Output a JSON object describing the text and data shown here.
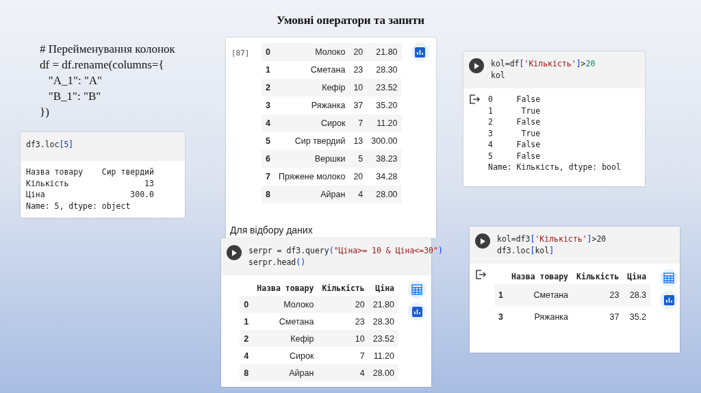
{
  "title": "Умовні оператори та запити",
  "note_lines": [
    "# Перейменування колонок",
    "df = df.rename(columns={",
    "   \"A_1\": \"A\"",
    "   \"B_1\": \"B\"",
    "})"
  ],
  "panels": [
    {
      "code": [
        [
          {
            "kind": "plain",
            "text": "df3.loc"
          },
          {
            "kind": "bracket",
            "text": "[5]"
          }
        ]
      ],
      "output_lines": [
        "Назва товару    Сир твердий",
        "Кількість                13",
        "Ціна                  300.0",
        "Name: 5, dtype: object"
      ]
    },
    {
      "exec_count": "[87]",
      "table": {
        "rows": [
          {
            "index": "0",
            "cells": [
              "Молоко",
              "20",
              "21.80"
            ]
          },
          {
            "index": "1",
            "cells": [
              "Сметана",
              "23",
              "28.30"
            ]
          },
          {
            "index": "2",
            "cells": [
              "Кефір",
              "10",
              "23.52"
            ]
          },
          {
            "index": "3",
            "cells": [
              "Ряжанка",
              "37",
              "35.20"
            ]
          },
          {
            "index": "4",
            "cells": [
              "Сирок",
              "7",
              "11.20"
            ]
          },
          {
            "index": "5",
            "cells": [
              "Сир твердий",
              "13",
              "300.00"
            ]
          },
          {
            "index": "6",
            "cells": [
              "Вершки",
              "5",
              "38.23"
            ]
          },
          {
            "index": "7",
            "cells": [
              "Пряжене молоко",
              "20",
              "34.28"
            ]
          },
          {
            "index": "8",
            "cells": [
              "Айран",
              "4",
              "28.00"
            ]
          }
        ],
        "chart_button": true
      },
      "caption": "Для відбору даних"
    },
    {
      "run_button": true,
      "output_icon": true,
      "code": [
        [
          {
            "kind": "plain",
            "text": "kol=df"
          },
          {
            "kind": "bracket",
            "text": "["
          },
          {
            "kind": "string",
            "text": "'Кількість'"
          },
          {
            "kind": "bracket",
            "text": "]"
          },
          {
            "kind": "plain",
            "text": ">"
          },
          {
            "kind": "number",
            "text": "20"
          }
        ],
        [
          {
            "kind": "plain",
            "text": "kol"
          }
        ]
      ],
      "output_lines": [
        "0     False",
        "1      True",
        "2     False",
        "3      True",
        "4     False",
        "5     False",
        "Name: Кількість, dtype: bool"
      ]
    },
    {
      "run_button": true,
      "code": [
        [
          {
            "kind": "plain",
            "text": "serpr = df3.query"
          },
          {
            "kind": "bracket",
            "text": "("
          },
          {
            "kind": "string",
            "text": "\"Ціна>= 10 & Ціна<=30\""
          },
          {
            "kind": "bracket",
            "text": ")"
          }
        ],
        [
          {
            "kind": "plain",
            "text": "serpr.head"
          },
          {
            "kind": "bracket",
            "text": "()"
          }
        ]
      ],
      "table": {
        "columns": [
          "Назва товару",
          "Кількість",
          "Ціна"
        ],
        "rows": [
          {
            "index": "0",
            "cells": [
              "Молоко",
              "20",
              "21.80"
            ]
          },
          {
            "index": "1",
            "cells": [
              "Сметана",
              "23",
              "28.30"
            ]
          },
          {
            "index": "2",
            "cells": [
              "Кефір",
              "10",
              "23.52"
            ]
          },
          {
            "index": "4",
            "cells": [
              "Сирок",
              "7",
              "11.20"
            ]
          },
          {
            "index": "8",
            "cells": [
              "Айран",
              "4",
              "28.00"
            ]
          }
        ],
        "table_button": true,
        "chart_button": true
      }
    },
    {
      "run_button": true,
      "output_icon": true,
      "code": [
        [
          {
            "kind": "plain",
            "text": "kol=df3"
          },
          {
            "kind": "bracket",
            "text": "["
          },
          {
            "kind": "string",
            "text": "'Кількість'"
          },
          {
            "kind": "bracket",
            "text": "]"
          },
          {
            "kind": "plain",
            "text": ">20"
          }
        ],
        [
          {
            "kind": "plain",
            "text": "df3.loc"
          },
          {
            "kind": "bracket",
            "text": "["
          },
          {
            "kind": "plain",
            "text": "kol"
          },
          {
            "kind": "bracket",
            "text": "]"
          }
        ]
      ],
      "table": {
        "columns": [
          "Назва товару",
          "Кількість",
          "Ціна"
        ],
        "rows": [
          {
            "index": "1",
            "cells": [
              "Сметана",
              "23",
              "28.3"
            ]
          },
          {
            "index": "3",
            "cells": [
              "Ряжанка",
              "37",
              "35.2"
            ]
          }
        ],
        "table_button": true,
        "chart_button": true
      }
    }
  ]
}
